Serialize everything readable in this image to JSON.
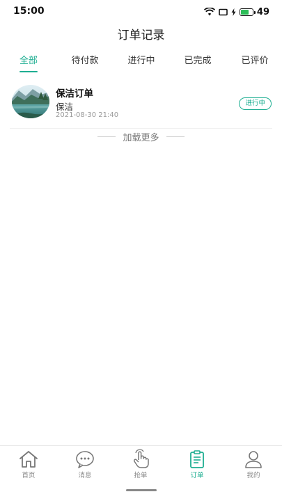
{
  "status_bar": {
    "time": "15:00",
    "battery_level": "49",
    "icons": [
      "wifi-icon",
      "screen-icon",
      "charging-icon",
      "battery-icon"
    ]
  },
  "page": {
    "title": "订单记录"
  },
  "tabs": [
    {
      "label": "全部",
      "active": true
    },
    {
      "label": "待付款",
      "active": false
    },
    {
      "label": "进行中",
      "active": false
    },
    {
      "label": "已完成",
      "active": false
    },
    {
      "label": "已评价",
      "active": false
    }
  ],
  "orders": [
    {
      "title": "保洁订单",
      "subtitle": "保洁",
      "time": "2021-08-30 21:40",
      "status": "进行中"
    }
  ],
  "list_footer": {
    "load_more": "加载更多"
  },
  "bottom_nav": [
    {
      "label": "首页",
      "icon": "home-icon",
      "active": false
    },
    {
      "label": "消息",
      "icon": "chat-icon",
      "active": false
    },
    {
      "label": "抢单",
      "icon": "hand-tap-icon",
      "active": false
    },
    {
      "label": "订单",
      "icon": "clipboard-icon",
      "active": true
    },
    {
      "label": "我的",
      "icon": "user-icon",
      "active": false
    }
  ],
  "colors": {
    "accent": "#1dae91",
    "battery": "#2dbd58",
    "muted_text": "#9a9a9a"
  }
}
